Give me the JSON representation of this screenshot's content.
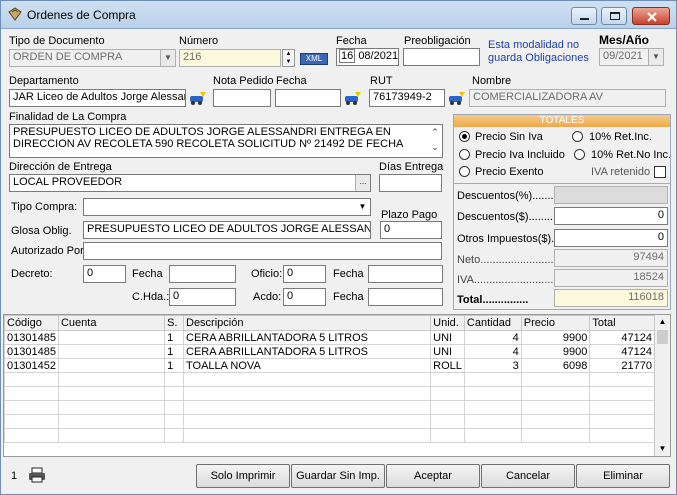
{
  "window": {
    "title": "Ordenes de Compra"
  },
  "header": {
    "tipo_doc_label": "Tipo de Documento",
    "tipo_doc_value": "ORDEN DE COMPRA",
    "numero_label": "Número",
    "numero_value": "216",
    "xml_label": "XML",
    "fecha_label": "Fecha",
    "fecha_day": "16",
    "fecha_rest": "08/2021",
    "preob_label": "Preobligación",
    "modalidad_note": "Esta modalidad no guarda Obligaciones",
    "mesano_label": "Mes/Año",
    "mesano_value": "09/2021",
    "depto_label": "Departamento",
    "depto_value": "JAR Liceo de Adultos Jorge Alessan",
    "nota_label": "Nota Pedido",
    "fecha2_label": "Fecha",
    "rut_label": "RUT",
    "rut_value": "76173949-2",
    "nombre_label": "Nombre",
    "nombre_value": "COMERCIALIZADORA  AV",
    "finalidad_label": "Finalidad de La Compra",
    "finalidad_value": "PRESUPUESTO LICEO DE ADULTOS JORGE ALESSANDRI ENTREGA EN DIRECCION AV RECOLETA 590 RECOLETA SOLICITUD Nº 21492 DE FECHA",
    "direccion_label": "Dirección de Entrega",
    "direccion_value": "LOCAL PROVEEDOR",
    "dias_label": "Días Entrega",
    "tipo_compra_label": "Tipo Compra:",
    "plazo_label": "Plazo Pago",
    "plazo_value": "0",
    "glosa_label": "Glosa Oblig.",
    "glosa_value": "PRESUPUESTO LICEO DE ADULTOS JORGE ALESSAND",
    "autorizado_label": "Autorizado Por:",
    "decreto_label": "Decreto:",
    "decreto_value": "0",
    "fecha3_label": "Fecha",
    "oficio_label": "Oficio:",
    "oficio_value": "0",
    "fecha4_label": "Fecha",
    "chda_label": "C.Hda.:",
    "chda_value": "0",
    "acdo_label": "Acdo:",
    "acdo_value": "0",
    "fecha5_label": "Fecha"
  },
  "totales": {
    "title": "TOTALES",
    "opt_sin_iva": "Precio Sin Iva",
    "opt_incluido": "Precio Iva Incluido",
    "opt_exento": "Precio Exento",
    "opt_ret_inc": "10% Ret.Inc.",
    "opt_ret_no_inc": "10% Ret.No Inc.",
    "iva_retenido": "IVA retenido",
    "desc_pct_label": "Descuentos(%)........",
    "desc_amt_label": "Descuentos($)........",
    "desc_amt_value": "0",
    "otros_label": "Otros Impuestos($)..",
    "otros_value": "0",
    "neto_label": "Neto...........................",
    "neto_value": "97494",
    "iva_label": "IVA...........................",
    "iva_value": "18524",
    "total_label": "Total...............",
    "total_value": "116018"
  },
  "grid": {
    "columns": [
      "Código",
      "Cuenta",
      "S.",
      "Descripción",
      "Unid.",
      "Cantidad",
      "Precio",
      "Total"
    ],
    "rows": [
      [
        "01301485",
        "",
        "1",
        "CERA ABRILLANTADORA 5 LITROS",
        "UNI",
        "4",
        "9900",
        "47124"
      ],
      [
        "01301485",
        "",
        "1",
        "CERA ABRILLANTADORA 5 LITROS",
        "UNI",
        "4",
        "9900",
        "47124"
      ],
      [
        "01301452",
        "",
        "1",
        "TOALLA NOVA",
        "ROLL",
        "3",
        "6098",
        "21770"
      ]
    ]
  },
  "footer": {
    "page": "1",
    "solo_imprimir": "Solo Imprimir",
    "guardar_sin_imp": "Guardar Sin Imp.",
    "aceptar": "Aceptar",
    "cancelar": "Cancelar",
    "eliminar": "Eliminar"
  },
  "colors": {
    "total_bg": "#fbf8dc",
    "panel_head": "#eda94a",
    "note_blue": "#1d3fa6"
  }
}
